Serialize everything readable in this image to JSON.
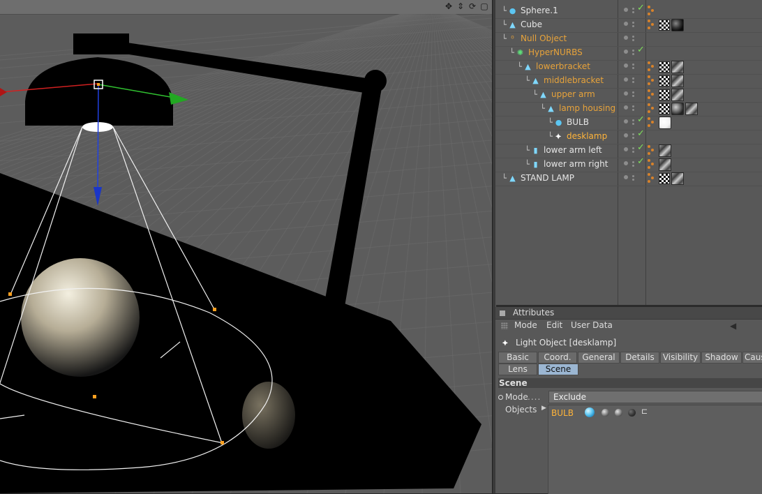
{
  "viewport": {
    "nav_icons": [
      "move-icon",
      "zoom-icon",
      "rotate-icon",
      "maximize-icon"
    ]
  },
  "object_manager": {
    "rows": [
      {
        "name": "Sphere.1",
        "color": "white",
        "depth": 0,
        "icon": "sphere-icon",
        "check": true,
        "tags": [
          "phong"
        ]
      },
      {
        "name": "Cube",
        "color": "white",
        "depth": 0,
        "icon": "cube-icon",
        "check": false,
        "tags": [
          "phong",
          "checker",
          "material-dark"
        ]
      },
      {
        "name": "Null Object",
        "color": "orange",
        "depth": 0,
        "icon": "null-icon",
        "check": false,
        "tags": []
      },
      {
        "name": "HyperNURBS",
        "color": "orange",
        "depth": 1,
        "icon": "hypernurbs-icon",
        "check": true,
        "tags": []
      },
      {
        "name": "lowerbracket",
        "color": "orange",
        "depth": 2,
        "icon": "cone-icon",
        "check": false,
        "tags": [
          "phong",
          "checker",
          "texture"
        ]
      },
      {
        "name": "middlebracket",
        "color": "orange",
        "depth": 3,
        "icon": "cone-icon",
        "check": false,
        "tags": [
          "phong",
          "checker",
          "texture"
        ]
      },
      {
        "name": "upper arm",
        "color": "orange",
        "depth": 4,
        "icon": "cone-icon",
        "check": false,
        "tags": [
          "phong",
          "checker",
          "texture"
        ]
      },
      {
        "name": "lamp housing",
        "color": "orange",
        "depth": 5,
        "icon": "cone-icon",
        "check": false,
        "tags": [
          "phong",
          "checker",
          "material-mid",
          "texture"
        ]
      },
      {
        "name": "BULB",
        "color": "white",
        "depth": 6,
        "icon": "sphere-icon",
        "check": true,
        "tags": [
          "phong",
          "material-white"
        ]
      },
      {
        "name": "desklamp",
        "color": "active",
        "depth": 6,
        "icon": "light-icon",
        "check": true,
        "tags": []
      },
      {
        "name": "lower arm left",
        "color": "white",
        "depth": 3,
        "icon": "cylinder-icon",
        "check": true,
        "tags": [
          "phong",
          "texture"
        ]
      },
      {
        "name": "lower arm right",
        "color": "white",
        "depth": 3,
        "icon": "cylinder-icon",
        "check": true,
        "tags": [
          "phong",
          "texture"
        ]
      },
      {
        "name": "STAND LAMP",
        "color": "white",
        "depth": 0,
        "icon": "cone-icon",
        "check": false,
        "tags": [
          "phong",
          "checker",
          "texture"
        ]
      }
    ]
  },
  "attributes": {
    "header": "Attributes",
    "menu": [
      "Mode",
      "Edit",
      "User Data"
    ],
    "object_title": "Light Object [desklamp]",
    "tabs_row1": [
      "Basic",
      "Coord.",
      "General",
      "Details",
      "Visibility",
      "Shadow",
      "Caus"
    ],
    "tabs_row2": [
      "Lens",
      "Scene"
    ],
    "active_tab": "Scene",
    "section": "Scene",
    "mode_label": "Mode",
    "mode_leader": "....",
    "mode_value": "Exclude",
    "objects_label": "Objects",
    "objects_list": [
      "BULB"
    ]
  },
  "colors": {
    "orange_text": "#e8a33a",
    "active_text": "#ffb43a",
    "check_green": "#7ee05a",
    "tab_active": "#9bb6d2"
  }
}
